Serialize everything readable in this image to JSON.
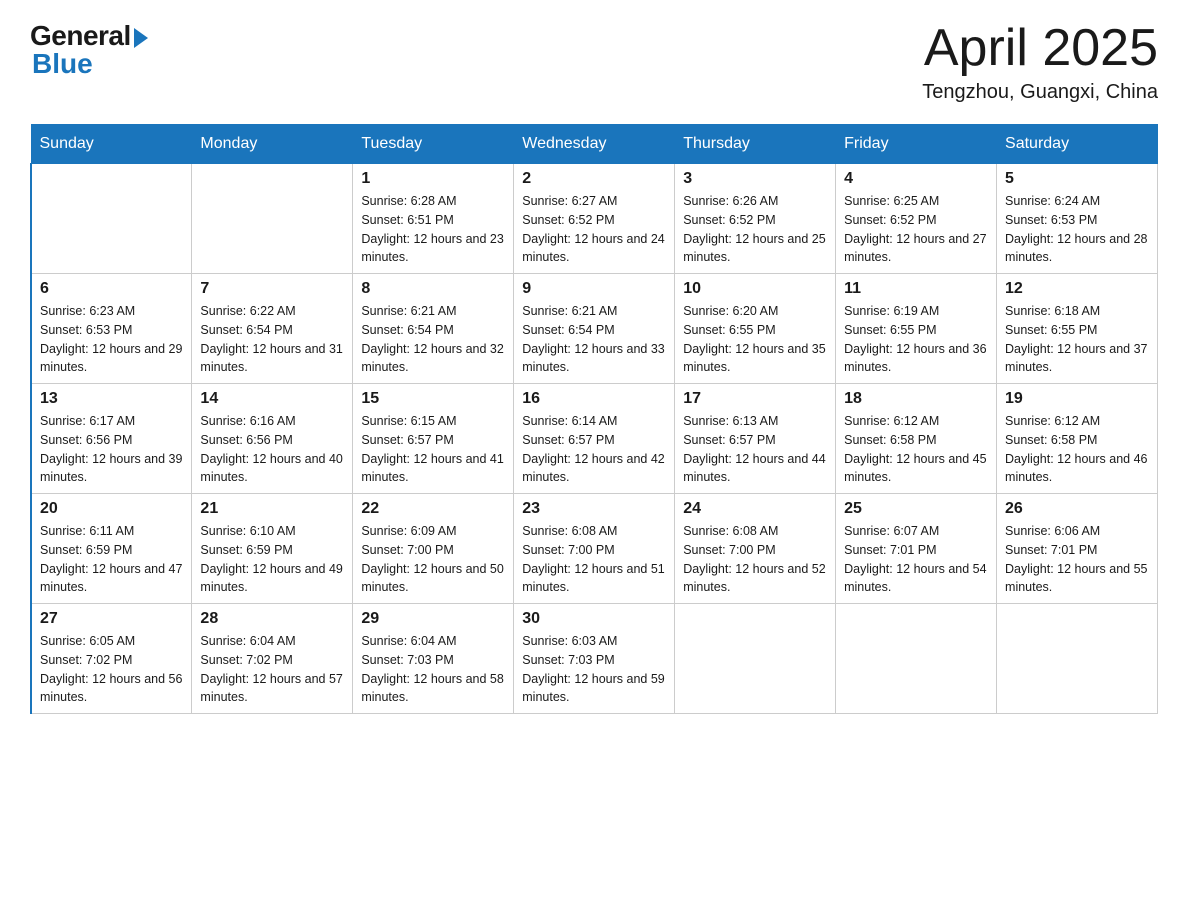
{
  "header": {
    "logo_general": "General",
    "logo_blue": "Blue",
    "main_title": "April 2025",
    "subtitle": "Tengzhou, Guangxi, China"
  },
  "days_of_week": [
    "Sunday",
    "Monday",
    "Tuesday",
    "Wednesday",
    "Thursday",
    "Friday",
    "Saturday"
  ],
  "weeks": [
    [
      {
        "day": "",
        "sunrise": "",
        "sunset": "",
        "daylight": ""
      },
      {
        "day": "",
        "sunrise": "",
        "sunset": "",
        "daylight": ""
      },
      {
        "day": "1",
        "sunrise": "Sunrise: 6:28 AM",
        "sunset": "Sunset: 6:51 PM",
        "daylight": "Daylight: 12 hours and 23 minutes."
      },
      {
        "day": "2",
        "sunrise": "Sunrise: 6:27 AM",
        "sunset": "Sunset: 6:52 PM",
        "daylight": "Daylight: 12 hours and 24 minutes."
      },
      {
        "day": "3",
        "sunrise": "Sunrise: 6:26 AM",
        "sunset": "Sunset: 6:52 PM",
        "daylight": "Daylight: 12 hours and 25 minutes."
      },
      {
        "day": "4",
        "sunrise": "Sunrise: 6:25 AM",
        "sunset": "Sunset: 6:52 PM",
        "daylight": "Daylight: 12 hours and 27 minutes."
      },
      {
        "day": "5",
        "sunrise": "Sunrise: 6:24 AM",
        "sunset": "Sunset: 6:53 PM",
        "daylight": "Daylight: 12 hours and 28 minutes."
      }
    ],
    [
      {
        "day": "6",
        "sunrise": "Sunrise: 6:23 AM",
        "sunset": "Sunset: 6:53 PM",
        "daylight": "Daylight: 12 hours and 29 minutes."
      },
      {
        "day": "7",
        "sunrise": "Sunrise: 6:22 AM",
        "sunset": "Sunset: 6:54 PM",
        "daylight": "Daylight: 12 hours and 31 minutes."
      },
      {
        "day": "8",
        "sunrise": "Sunrise: 6:21 AM",
        "sunset": "Sunset: 6:54 PM",
        "daylight": "Daylight: 12 hours and 32 minutes."
      },
      {
        "day": "9",
        "sunrise": "Sunrise: 6:21 AM",
        "sunset": "Sunset: 6:54 PM",
        "daylight": "Daylight: 12 hours and 33 minutes."
      },
      {
        "day": "10",
        "sunrise": "Sunrise: 6:20 AM",
        "sunset": "Sunset: 6:55 PM",
        "daylight": "Daylight: 12 hours and 35 minutes."
      },
      {
        "day": "11",
        "sunrise": "Sunrise: 6:19 AM",
        "sunset": "Sunset: 6:55 PM",
        "daylight": "Daylight: 12 hours and 36 minutes."
      },
      {
        "day": "12",
        "sunrise": "Sunrise: 6:18 AM",
        "sunset": "Sunset: 6:55 PM",
        "daylight": "Daylight: 12 hours and 37 minutes."
      }
    ],
    [
      {
        "day": "13",
        "sunrise": "Sunrise: 6:17 AM",
        "sunset": "Sunset: 6:56 PM",
        "daylight": "Daylight: 12 hours and 39 minutes."
      },
      {
        "day": "14",
        "sunrise": "Sunrise: 6:16 AM",
        "sunset": "Sunset: 6:56 PM",
        "daylight": "Daylight: 12 hours and 40 minutes."
      },
      {
        "day": "15",
        "sunrise": "Sunrise: 6:15 AM",
        "sunset": "Sunset: 6:57 PM",
        "daylight": "Daylight: 12 hours and 41 minutes."
      },
      {
        "day": "16",
        "sunrise": "Sunrise: 6:14 AM",
        "sunset": "Sunset: 6:57 PM",
        "daylight": "Daylight: 12 hours and 42 minutes."
      },
      {
        "day": "17",
        "sunrise": "Sunrise: 6:13 AM",
        "sunset": "Sunset: 6:57 PM",
        "daylight": "Daylight: 12 hours and 44 minutes."
      },
      {
        "day": "18",
        "sunrise": "Sunrise: 6:12 AM",
        "sunset": "Sunset: 6:58 PM",
        "daylight": "Daylight: 12 hours and 45 minutes."
      },
      {
        "day": "19",
        "sunrise": "Sunrise: 6:12 AM",
        "sunset": "Sunset: 6:58 PM",
        "daylight": "Daylight: 12 hours and 46 minutes."
      }
    ],
    [
      {
        "day": "20",
        "sunrise": "Sunrise: 6:11 AM",
        "sunset": "Sunset: 6:59 PM",
        "daylight": "Daylight: 12 hours and 47 minutes."
      },
      {
        "day": "21",
        "sunrise": "Sunrise: 6:10 AM",
        "sunset": "Sunset: 6:59 PM",
        "daylight": "Daylight: 12 hours and 49 minutes."
      },
      {
        "day": "22",
        "sunrise": "Sunrise: 6:09 AM",
        "sunset": "Sunset: 7:00 PM",
        "daylight": "Daylight: 12 hours and 50 minutes."
      },
      {
        "day": "23",
        "sunrise": "Sunrise: 6:08 AM",
        "sunset": "Sunset: 7:00 PM",
        "daylight": "Daylight: 12 hours and 51 minutes."
      },
      {
        "day": "24",
        "sunrise": "Sunrise: 6:08 AM",
        "sunset": "Sunset: 7:00 PM",
        "daylight": "Daylight: 12 hours and 52 minutes."
      },
      {
        "day": "25",
        "sunrise": "Sunrise: 6:07 AM",
        "sunset": "Sunset: 7:01 PM",
        "daylight": "Daylight: 12 hours and 54 minutes."
      },
      {
        "day": "26",
        "sunrise": "Sunrise: 6:06 AM",
        "sunset": "Sunset: 7:01 PM",
        "daylight": "Daylight: 12 hours and 55 minutes."
      }
    ],
    [
      {
        "day": "27",
        "sunrise": "Sunrise: 6:05 AM",
        "sunset": "Sunset: 7:02 PM",
        "daylight": "Daylight: 12 hours and 56 minutes."
      },
      {
        "day": "28",
        "sunrise": "Sunrise: 6:04 AM",
        "sunset": "Sunset: 7:02 PM",
        "daylight": "Daylight: 12 hours and 57 minutes."
      },
      {
        "day": "29",
        "sunrise": "Sunrise: 6:04 AM",
        "sunset": "Sunset: 7:03 PM",
        "daylight": "Daylight: 12 hours and 58 minutes."
      },
      {
        "day": "30",
        "sunrise": "Sunrise: 6:03 AM",
        "sunset": "Sunset: 7:03 PM",
        "daylight": "Daylight: 12 hours and 59 minutes."
      },
      {
        "day": "",
        "sunrise": "",
        "sunset": "",
        "daylight": ""
      },
      {
        "day": "",
        "sunrise": "",
        "sunset": "",
        "daylight": ""
      },
      {
        "day": "",
        "sunrise": "",
        "sunset": "",
        "daylight": ""
      }
    ]
  ]
}
